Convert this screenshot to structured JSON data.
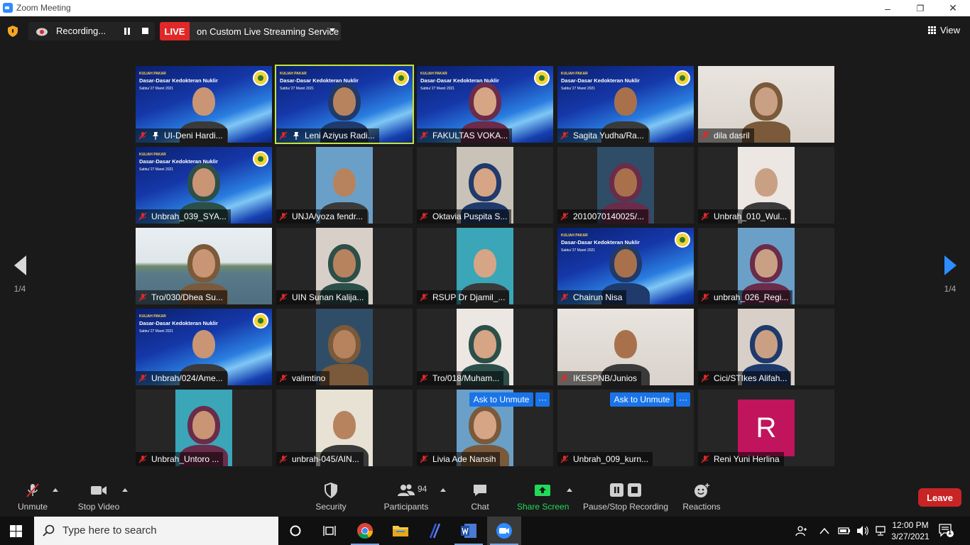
{
  "window": {
    "title": "Zoom Meeting",
    "minimize": "–",
    "restore": "❐",
    "close": "✕"
  },
  "topbar": {
    "recording_text": "Recording...",
    "live_badge": "LIVE",
    "live_service": "on Custom Live Streaming Service",
    "view_label": "View"
  },
  "slide": {
    "kicker": "KULIAH PAKAR",
    "title": "Dasar-Dasar Kedokteran Nuklir",
    "date": "Sabtu/ 27 Maret 2021"
  },
  "participants": [
    {
      "name": "UI-Deni Hardi...",
      "bg": "slide",
      "pinned": true
    },
    {
      "name": "Leni Aziyus Radi...",
      "bg": "slide",
      "pinned": true,
      "active": true
    },
    {
      "name": "FAKULTAS VOKA...",
      "bg": "slide"
    },
    {
      "name": "Sagita Yudha/Ra...",
      "bg": "slide"
    },
    {
      "name": "dila dasril",
      "bg": "room"
    },
    {
      "name": "Unbrah_039_SYA...",
      "bg": "slide"
    },
    {
      "name": "UNJA/yoza fendr...",
      "bg": "portrait"
    },
    {
      "name": "Oktavia Puspita S...",
      "bg": "portrait"
    },
    {
      "name": "2010070140025/...",
      "bg": "portrait"
    },
    {
      "name": "Unbrah_010_Wul...",
      "bg": "portrait"
    },
    {
      "name": "Tro/030/Dhea Su...",
      "bg": "sea"
    },
    {
      "name": "UIN Sunan Kalija...",
      "bg": "portrait"
    },
    {
      "name": "RSUP Dr Djamil_...",
      "bg": "portrait"
    },
    {
      "name": "Chairun Nisa",
      "bg": "slide"
    },
    {
      "name": "unbrah_026_Regi...",
      "bg": "portrait"
    },
    {
      "name": "Unbrah/024/Ame...",
      "bg": "slide"
    },
    {
      "name": "valimtino",
      "bg": "portrait"
    },
    {
      "name": "Tro/018/Muham...",
      "bg": "portrait"
    },
    {
      "name": "IKESPNB/Junios",
      "bg": "room"
    },
    {
      "name": "Cici/STIkes Alifah...",
      "bg": "portrait"
    },
    {
      "name": "Unbrah_Untoro ...",
      "bg": "portrait"
    },
    {
      "name": "unbrah-045/AIN...",
      "bg": "portrait"
    },
    {
      "name": "Livia Ade Nansih",
      "bg": "portrait",
      "ask_unmute": true
    },
    {
      "name": "Unbrah_009_kurn...",
      "bg": "none",
      "ask_unmute": true
    },
    {
      "name": "Reni Yuni Herlina",
      "bg": "avatar",
      "avatar_letter": "R"
    }
  ],
  "ask_to_unmute_label": "Ask to Unmute",
  "more_label": "···",
  "pagination": {
    "left": "1/4",
    "right": "1/4"
  },
  "toolbar": {
    "unmute": "Unmute",
    "stop_video": "Stop Video",
    "security": "Security",
    "participants": "Participants",
    "participants_count": "94",
    "chat": "Chat",
    "share_screen": "Share Screen",
    "pause_stop_recording": "Pause/Stop Recording",
    "reactions": "Reactions",
    "leave": "Leave"
  },
  "taskbar": {
    "search_placeholder": "Type here to search",
    "time": "12:00 PM",
    "date": "3/27/2021",
    "notification_count": "1"
  },
  "colors": {
    "accent": "#2d8cff",
    "live_red": "#e02828",
    "active_speaker": "#c6e33a",
    "leave_red": "#c82424",
    "share_green": "#23d959",
    "ask_unmute_blue": "#1a73e8",
    "avatar_pink": "#c0145c"
  }
}
